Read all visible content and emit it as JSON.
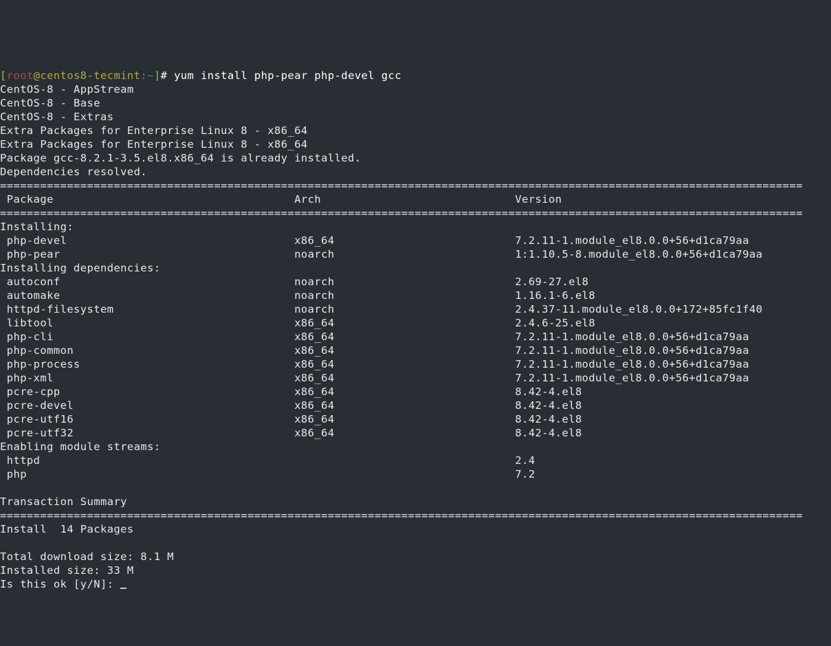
{
  "prompt": {
    "open_bracket": "[",
    "user": "root",
    "at": "@",
    "host": "centos8-tecmint",
    "colon": ":",
    "path": "~",
    "close_bracket": "]",
    "hash": "# ",
    "command": "yum install php-pear php-devel gcc"
  },
  "repos": [
    "CentOS-8 - AppStream",
    "CentOS-8 - Base",
    "CentOS-8 - Extras",
    "Extra Packages for Enterprise Linux 8 - x86_64",
    "Extra Packages for Enterprise Linux 8 - x86_64"
  ],
  "already": "Package gcc-8.2.1-3.5.el8.x86_64 is already installed.",
  "deps": "Dependencies resolved.",
  "hr": "========================================================================================================================",
  "hdr": {
    "pkg": " Package",
    "arch": "Arch",
    "ver": "Version"
  },
  "sec_install": "Installing:",
  "install_rows": [
    {
      "pkg": " php-devel",
      "arch": "x86_64",
      "ver": "7.2.11-1.module_el8.0.0+56+d1ca79aa"
    },
    {
      "pkg": " php-pear",
      "arch": "noarch",
      "ver": "1:1.10.5-8.module_el8.0.0+56+d1ca79aa"
    }
  ],
  "sec_deps": "Installing dependencies:",
  "dep_rows": [
    {
      "pkg": " autoconf",
      "arch": "noarch",
      "ver": "2.69-27.el8"
    },
    {
      "pkg": " automake",
      "arch": "noarch",
      "ver": "1.16.1-6.el8"
    },
    {
      "pkg": " httpd-filesystem",
      "arch": "noarch",
      "ver": "2.4.37-11.module_el8.0.0+172+85fc1f40"
    },
    {
      "pkg": " libtool",
      "arch": "x86_64",
      "ver": "2.4.6-25.el8"
    },
    {
      "pkg": " php-cli",
      "arch": "x86_64",
      "ver": "7.2.11-1.module_el8.0.0+56+d1ca79aa"
    },
    {
      "pkg": " php-common",
      "arch": "x86_64",
      "ver": "7.2.11-1.module_el8.0.0+56+d1ca79aa"
    },
    {
      "pkg": " php-process",
      "arch": "x86_64",
      "ver": "7.2.11-1.module_el8.0.0+56+d1ca79aa"
    },
    {
      "pkg": " php-xml",
      "arch": "x86_64",
      "ver": "7.2.11-1.module_el8.0.0+56+d1ca79aa"
    },
    {
      "pkg": " pcre-cpp",
      "arch": "x86_64",
      "ver": "8.42-4.el8"
    },
    {
      "pkg": " pcre-devel",
      "arch": "x86_64",
      "ver": "8.42-4.el8"
    },
    {
      "pkg": " pcre-utf16",
      "arch": "x86_64",
      "ver": "8.42-4.el8"
    },
    {
      "pkg": " pcre-utf32",
      "arch": "x86_64",
      "ver": "8.42-4.el8"
    }
  ],
  "sec_streams": "Enabling module streams:",
  "stream_rows": [
    {
      "pkg": " httpd",
      "arch": "",
      "ver": "2.4"
    },
    {
      "pkg": " php",
      "arch": "",
      "ver": "7.2"
    }
  ],
  "blank": "",
  "summary_title": "Transaction Summary",
  "install_count": "Install  14 Packages",
  "dl_size": "Total download size: 8.1 M",
  "inst_size": "Installed size: 33 M",
  "confirm": "Is this ok [y/N]: "
}
